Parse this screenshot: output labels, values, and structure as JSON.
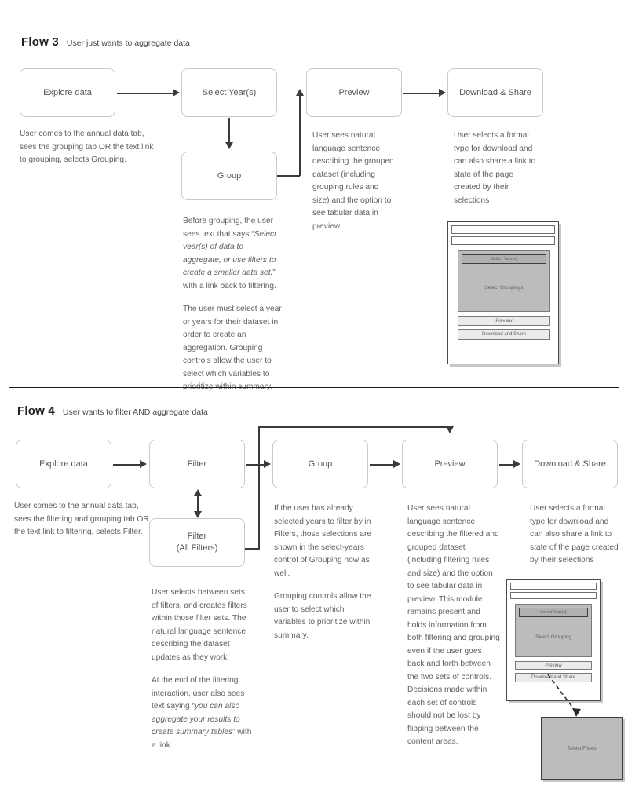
{
  "flow3": {
    "title": "Flow 3",
    "subtitle": "User just wants to aggregate data",
    "nodes": {
      "explore": "Explore data",
      "select_years": "Select Year(s)",
      "group": "Group",
      "preview": "Preview",
      "download": "Download & Share"
    },
    "captions": {
      "explore": "User comes to the annual data tab, sees the grouping tab OR the text link to grouping, selects Grouping.",
      "group_p1_a": "Before grouping, the user sees text that says “",
      "group_p1_italic": "Select year(s) of data to aggregate, or use filters to create a smaller data set.",
      "group_p1_b": "” with a link back to filtering.",
      "group_p2": "The user must select a year or years for their dataset in order to create an aggregation. Grouping controls allow the user to select which variables to prioritize within summary.",
      "preview": "User sees natural language sentence describing the grouped dataset (including grouping rules and size) and the option to see tabular data in preview",
      "download": "User selects a format type for download and can also share a link to state of the page created by their selections"
    },
    "wireframe": {
      "panel_head": "Select Year(s)",
      "panel_body": "Select Groupings",
      "btn_preview": "Preview",
      "btn_download": "Download and Share"
    }
  },
  "flow4": {
    "title": "Flow 4",
    "subtitle": "User wants to filter AND aggregate data",
    "nodes": {
      "explore": "Explore data",
      "filter": "Filter",
      "filter_all_line1": "Filter",
      "filter_all_line2": "(All Filters)",
      "group": "Group",
      "preview": "Preview",
      "download": "Download & Share"
    },
    "captions": {
      "explore": "User comes to the annual data tab, sees the filtering and grouping tab OR the text link to filtering, selects Filter.",
      "filter_p1": "User selects between sets of filters, and creates filters within those filter sets. The natural language sentence describing the dataset updates as they work.",
      "filter_p2_a": "At the end of the filtering interaction, user also sees text saying “",
      "filter_p2_italic": "you can also aggregate your results to create summary tables",
      "filter_p2_b": "” with a link",
      "group_p1": "If the user has already selected years to filter by in Filters, those selections are shown in the select-years control of Grouping now as well.",
      "group_p2": "Grouping controls allow the user to select which variables to prioritize within summary.",
      "preview": "User sees natural language sentence describing the filtered and grouped dataset (including filtering rules and size) and the option to see tabular data in preview. This module remains present and holds information from both filtering and grouping even if the user goes back and forth between the two sets of controls. Decisions made within each set of controls should not be lost by flipping between the content areas.",
      "download": "User selects a format type for download and can also share a link to state of the page created by their selections"
    },
    "wireframe": {
      "panel_head": "Select Year(s)",
      "panel_body": "Select Grouping",
      "btn_preview": "Preview",
      "btn_download": "Download and Share",
      "popup": "Select Filters"
    }
  },
  "colors": {
    "node_border": "#c9c9c9",
    "connector": "#3a3a3a",
    "caption_text": "#5f5f5f",
    "divider": "#1a1a1a",
    "wire_panel": "#bcbcbc"
  }
}
